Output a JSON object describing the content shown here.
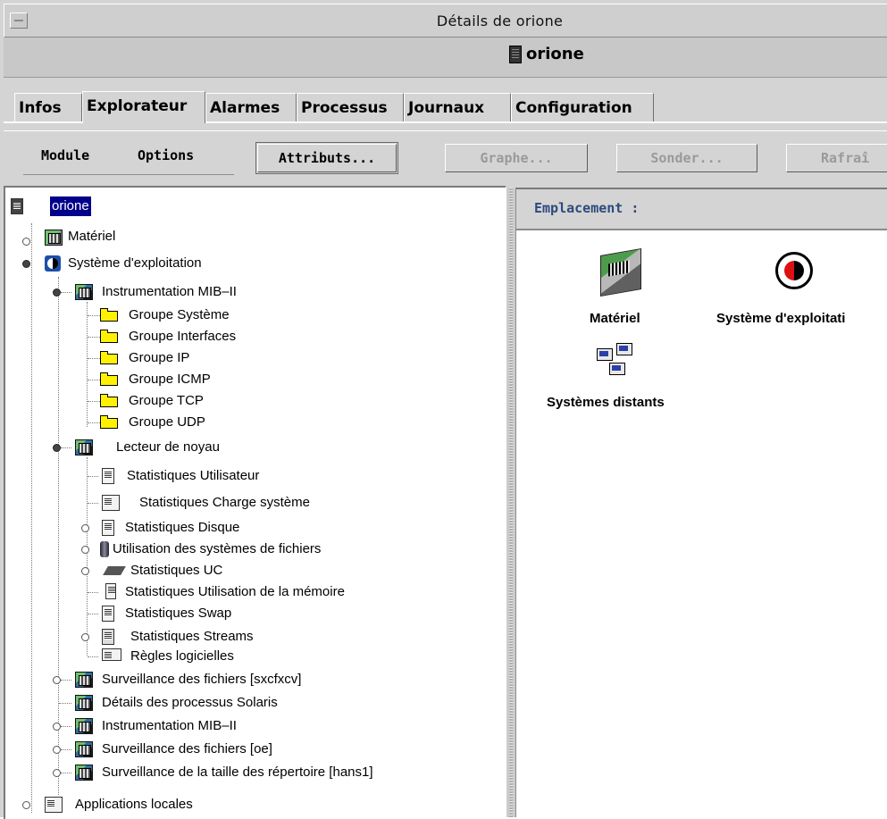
{
  "window": {
    "title": "Détails de orione"
  },
  "host": {
    "name": "orione"
  },
  "tabs": [
    {
      "label": "Infos"
    },
    {
      "label": "Explorateur"
    },
    {
      "label": "Alarmes"
    },
    {
      "label": "Processus"
    },
    {
      "label": "Journaux"
    },
    {
      "label": "Configuration"
    }
  ],
  "active_tab": "Explorateur",
  "toolbar": {
    "menus": [
      "Module",
      "Options"
    ],
    "buttons": [
      {
        "label": "Attributs...",
        "enabled": true
      },
      {
        "label": "Graphe...",
        "enabled": false
      },
      {
        "label": "Sonder...",
        "enabled": false
      },
      {
        "label": "Rafraî",
        "enabled": false
      }
    ]
  },
  "tree": {
    "root": "orione",
    "items": [
      {
        "label": "Matériel",
        "icon": "hardware-icon"
      },
      {
        "label": "Système d'exploitation",
        "icon": "os-icon"
      },
      {
        "label": "Instrumentation MIB–II",
        "icon": "module-icon"
      },
      {
        "label": "Groupe Système",
        "icon": "folder-icon"
      },
      {
        "label": "Groupe Interfaces",
        "icon": "folder-icon"
      },
      {
        "label": "Groupe IP",
        "icon": "folder-icon"
      },
      {
        "label": "Groupe ICMP",
        "icon": "folder-icon"
      },
      {
        "label": "Groupe TCP",
        "icon": "folder-icon"
      },
      {
        "label": "Groupe UDP",
        "icon": "folder-icon"
      },
      {
        "label": "Lecteur de noyau",
        "icon": "module-icon"
      },
      {
        "label": "Statistiques Utilisateur",
        "icon": "user-stats-icon"
      },
      {
        "label": "Statistiques Charge système",
        "icon": "load-icon"
      },
      {
        "label": "Statistiques Disque",
        "icon": "disk-icon"
      },
      {
        "label": "Utilisation des systèmes de fichiers",
        "icon": "filesystem-icon"
      },
      {
        "label": "Statistiques UC",
        "icon": "cpu-icon"
      },
      {
        "label": "Statistiques Utilisation de la mémoire",
        "icon": "memory-icon"
      },
      {
        "label": "Statistiques Swap",
        "icon": "swap-icon"
      },
      {
        "label": "Statistiques Streams",
        "icon": "streams-icon"
      },
      {
        "label": "Règles logicielles",
        "icon": "rules-icon"
      },
      {
        "label": "Surveillance des fichiers [sxcfxcv]",
        "icon": "module-icon"
      },
      {
        "label": "Détails des processus Solaris",
        "icon": "module-icon"
      },
      {
        "label": "Instrumentation MIB–II",
        "icon": "module-icon"
      },
      {
        "label": "Surveillance des fichiers [oe]",
        "icon": "module-icon"
      },
      {
        "label": "Surveillance de la taille des répertoire [hans1]",
        "icon": "module-icon"
      },
      {
        "label": "Applications locales",
        "icon": "apps-icon"
      }
    ]
  },
  "right": {
    "location_label": "Emplacement :",
    "icons": [
      {
        "label": "Matériel",
        "icon": "hardware-icon"
      },
      {
        "label": "Système d'exploitati",
        "icon": "os-icon"
      },
      {
        "label": "Systèmes distants",
        "icon": "remote-systems-icon"
      }
    ]
  }
}
